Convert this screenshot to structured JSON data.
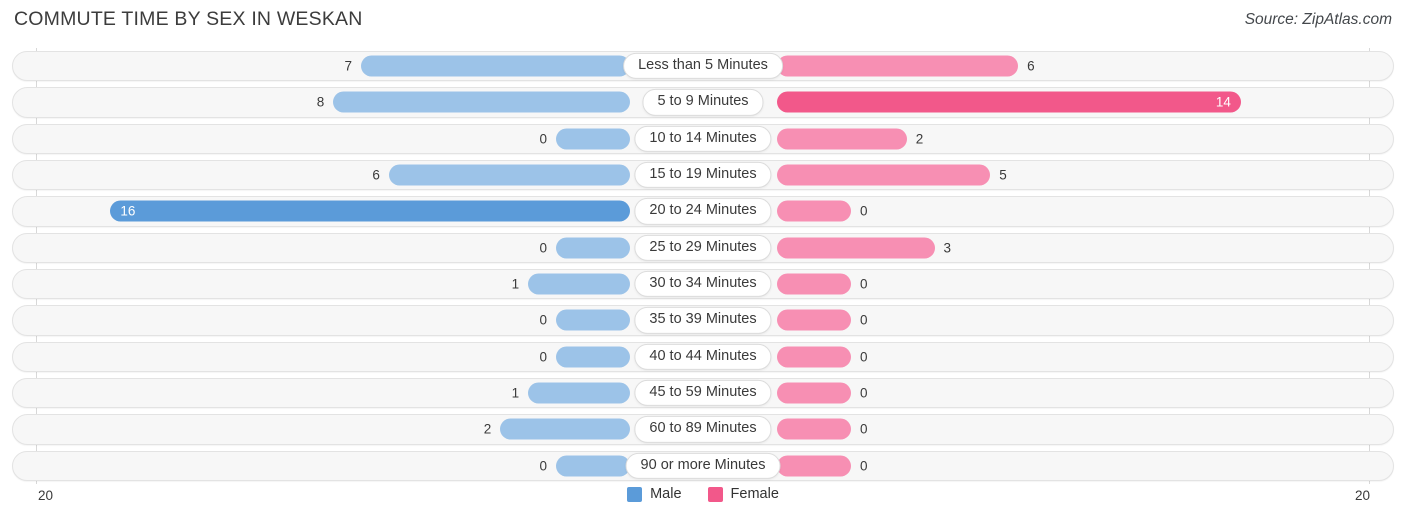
{
  "header": {
    "title": "COMMUTE TIME BY SEX IN WESKAN",
    "source": "Source: ZipAtlas.com"
  },
  "axis": {
    "left_label": "20",
    "right_label": "20",
    "max": 20
  },
  "legend": {
    "items": [
      {
        "label": "Male",
        "color": "#5b9bd9"
      },
      {
        "label": "Female",
        "color": "#f2588a"
      }
    ]
  },
  "colors": {
    "male_light": "#9cc3e8",
    "male_strong": "#5b9bd9",
    "female_light": "#f78fb3",
    "female_strong": "#f2588a",
    "track_bg": "#f7f7f7",
    "track_border": "#e3e3e3",
    "gridline": "#d8d8d8"
  },
  "chart_data": {
    "type": "bar",
    "title": "COMMUTE TIME BY SEX IN WESKAN",
    "subtitle": "Source: ZipAtlas.com",
    "orientation": "horizontal",
    "layout": "diverging-bidirectional",
    "xlabel": "",
    "ylabel": "",
    "xlim": [
      20,
      20
    ],
    "grid": true,
    "legend_position": "bottom-center",
    "categories": [
      "Less than 5 Minutes",
      "5 to 9 Minutes",
      "10 to 14 Minutes",
      "15 to 19 Minutes",
      "20 to 24 Minutes",
      "25 to 29 Minutes",
      "30 to 34 Minutes",
      "35 to 39 Minutes",
      "40 to 44 Minutes",
      "45 to 59 Minutes",
      "60 to 89 Minutes",
      "90 or more Minutes"
    ],
    "series": [
      {
        "name": "Male",
        "values": [
          7,
          8,
          0,
          6,
          16,
          0,
          1,
          0,
          0,
          1,
          2,
          0
        ]
      },
      {
        "name": "Female",
        "values": [
          6,
          14,
          2,
          5,
          0,
          3,
          0,
          0,
          0,
          0,
          0,
          0
        ]
      }
    ]
  },
  "rows": [
    {
      "label": "Less than 5 Minutes",
      "male": "7",
      "female": "6",
      "male_val": 7,
      "female_val": 6
    },
    {
      "label": "5 to 9 Minutes",
      "male": "8",
      "female": "14",
      "male_val": 8,
      "female_val": 14
    },
    {
      "label": "10 to 14 Minutes",
      "male": "0",
      "female": "2",
      "male_val": 0,
      "female_val": 2
    },
    {
      "label": "15 to 19 Minutes",
      "male": "6",
      "female": "5",
      "male_val": 6,
      "female_val": 5
    },
    {
      "label": "20 to 24 Minutes",
      "male": "16",
      "female": "0",
      "male_val": 16,
      "female_val": 0
    },
    {
      "label": "25 to 29 Minutes",
      "male": "0",
      "female": "3",
      "male_val": 0,
      "female_val": 3
    },
    {
      "label": "30 to 34 Minutes",
      "male": "1",
      "female": "0",
      "male_val": 1,
      "female_val": 0
    },
    {
      "label": "35 to 39 Minutes",
      "male": "0",
      "female": "0",
      "male_val": 0,
      "female_val": 0
    },
    {
      "label": "40 to 44 Minutes",
      "male": "0",
      "female": "0",
      "male_val": 0,
      "female_val": 0
    },
    {
      "label": "45 to 59 Minutes",
      "male": "1",
      "female": "0",
      "male_val": 1,
      "female_val": 0
    },
    {
      "label": "60 to 89 Minutes",
      "male": "2",
      "female": "0",
      "male_val": 2,
      "female_val": 0
    },
    {
      "label": "90 or more Minutes",
      "male": "0",
      "female": "0",
      "male_val": 0,
      "female_val": 0
    }
  ]
}
